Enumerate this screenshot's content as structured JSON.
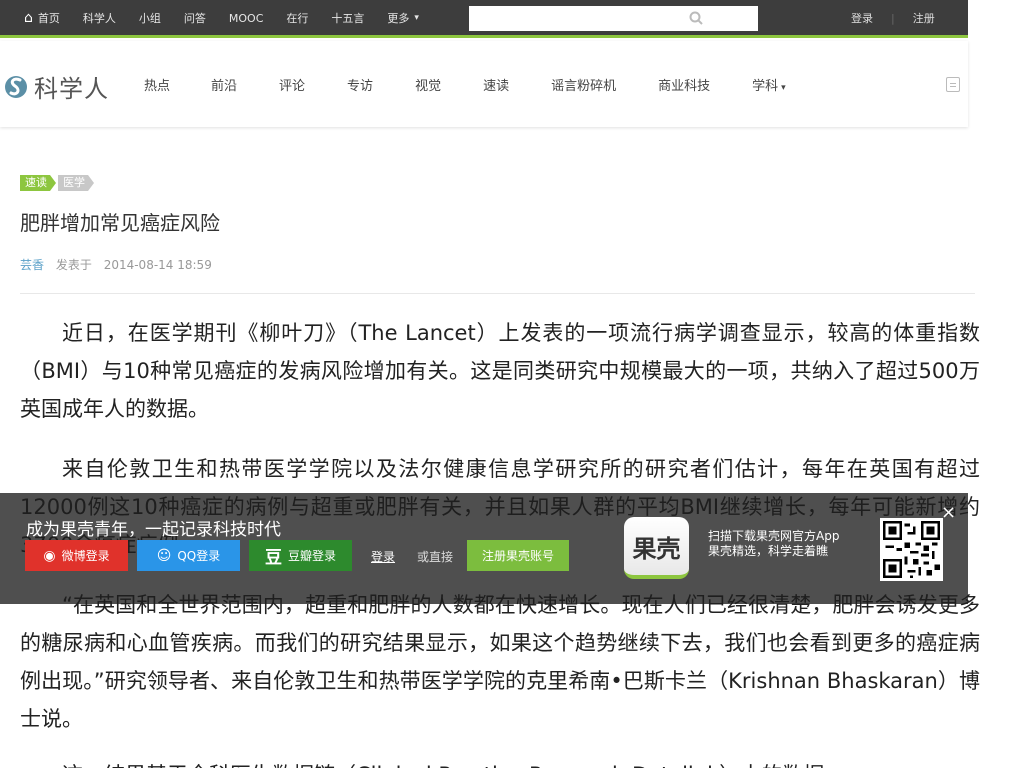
{
  "topbar": {
    "nav": [
      "首页",
      "科学人",
      "小组",
      "问答",
      "MOOC",
      "在行",
      "十五言",
      "更多"
    ],
    "more_caret": "▾",
    "search_placeholder": "",
    "login": "登录",
    "register": "注册"
  },
  "header": {
    "logo_text": "科学人",
    "nav": [
      "热点",
      "前沿",
      "评论",
      "专访",
      "视觉",
      "速读",
      "谣言粉碎机",
      "商业科技",
      "学科"
    ],
    "subject_caret": "▾"
  },
  "article": {
    "tags": [
      "速读",
      "医学"
    ],
    "title": "肥胖增加常见癌症风险",
    "author": "芸香",
    "published_label": "发表于",
    "datetime": "2014-08-14 18:59",
    "paragraphs": [
      "近日，在医学期刊《柳叶刀》（The Lancet）上发表的一项流行病学调查显示，较高的体重指数（BMI）与10种常见癌症的发病风险增加有关。这是同类研究中规模最大的一项，共纳入了超过500万英国成年人的数据。",
      "来自伦敦卫生和热带医学学院以及法尔健康信息学研究所的研究者们估计，每年在英国有超过12000例这10种癌症的病例与超重或肥胖有关，并且如果人群的平均BMI继续增长，每年可能新增约3700余癌症病例。",
      "“在英国和全世界范围内，超重和肥胖的人数都在快速增长。现在人们已经很清楚，肥胖会诱发更多的糖尿病和心血管疾病。而我们的研究结果显示，如果这个趋势继续下去，我们也会看到更多的癌症病例出现。”研究领导者、来自伦敦卫生和热带医学学院的克里希南•巴斯卡兰（Krishnan Bhaskaran）博士说。",
      "这一结果基于全科医生数据链（Clinical Practice Research Datalink）中的数据"
    ]
  },
  "overlay": {
    "slogan": "成为果壳青年，一起记录科技时代",
    "weibo": "微博登录",
    "qq": "QQ登录",
    "douban": "豆瓣登录",
    "login_link": "登录",
    "or_direct": "或直接",
    "register_btn": "注册果壳账号",
    "app_name": "果壳",
    "scan_line1": "扫描下载果壳网官方App",
    "scan_line2": "果壳精选，科学走着瞧",
    "close": "×"
  },
  "colors": {
    "accent_green": "#8dc63f",
    "topbar_bg": "#3d3d3d",
    "weibo_red": "#e0322b",
    "qq_blue": "#2a95e8",
    "douban_green": "#2d8a2d"
  }
}
